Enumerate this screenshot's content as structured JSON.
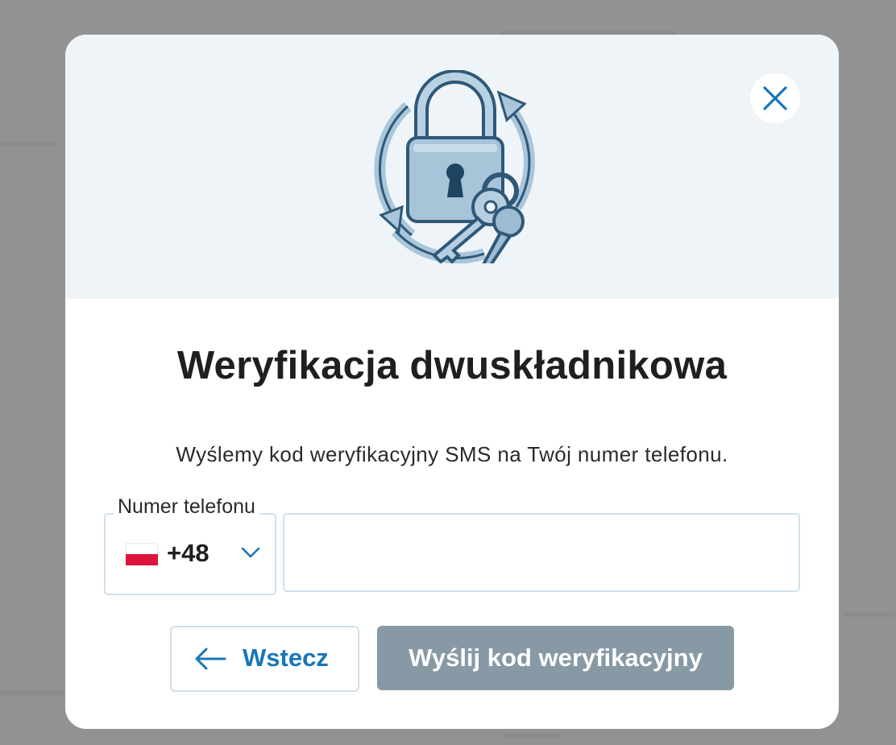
{
  "dialog": {
    "title": "Weryfikacja dwuskładnikowa",
    "description": "Wyślemy kod weryfikacyjny SMS na Twój numer telefonu.",
    "illustration_icon": "padlock-with-keys-illustration",
    "close_icon": "close-icon"
  },
  "phone_field": {
    "label": "Numer telefonu",
    "country_flag": "poland-flag-icon",
    "dial_code": "+48",
    "dropdown_icon": "chevron-down-icon",
    "value": "",
    "placeholder": ""
  },
  "actions": {
    "back_label": "Wstecz",
    "back_icon": "arrow-left-icon",
    "send_label": "Wyślij kod weryfikacyjny"
  },
  "colors": {
    "accent": "#1976b8",
    "disabled_button": "#8799a5",
    "hero_background": "#eef4f8",
    "input_border": "#cfe1ec",
    "overlay": "#929292"
  }
}
